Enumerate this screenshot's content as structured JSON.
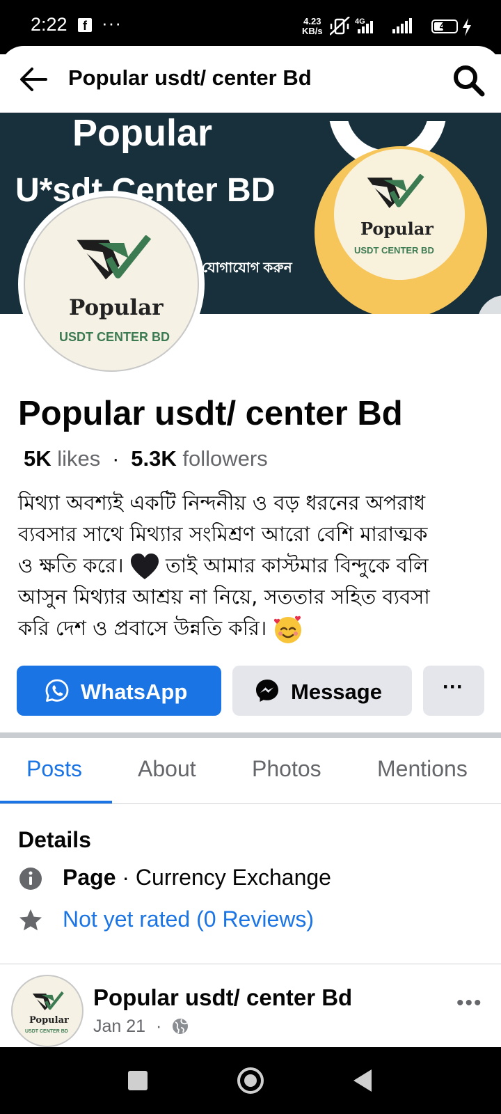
{
  "status_bar": {
    "time": "2:22",
    "notification_icons": [
      "facebook-icon",
      "more-notifications-icon"
    ],
    "network_speed_value": "4.23",
    "network_speed_unit": "KB/s",
    "network_type": "4G",
    "battery_level": "42"
  },
  "header": {
    "title": "Popular usdt/ center Bd",
    "back_icon": "back-arrow-icon",
    "search_icon": "search-icon"
  },
  "cover": {
    "line1": "Popular",
    "line2": "U*sdt Center BD",
    "line3": "যোগাযোগ করুন",
    "badge_word": "Popular",
    "badge_sub": "USDT CENTER BD"
  },
  "avatar": {
    "word": "Popular",
    "sub": "USDT CENTER BD"
  },
  "profile": {
    "name": "Popular usdt/ center Bd",
    "likes_count": "5K",
    "likes_label": "likes",
    "separator": "·",
    "followers_count": "5.3K",
    "followers_label": "followers",
    "bio_line1": "মিথ্যা অবশ্যই একটি নিন্দনীয় ও বড় ধরনের অপরাধ",
    "bio_line2": "ব্যবসার সাথে মিথ্যার সংমিশ্রণ আরো বেশি মারাত্মক",
    "bio_line3a": "ও ক্ষতি করে।",
    "bio_line3b": "তাই আমার কাস্টমার বিন্দুকে বলি",
    "bio_line4": "আসুন মিথ্যার আশ্রয় না নিয়ে,  সততার সহিত ব্যবসা",
    "bio_line5": "করি দেশ ও প্রবাসে উন্নতি করি।",
    "bio_emoji_1": "black-heart",
    "bio_emoji_2": "smiling-face-with-hearts"
  },
  "actions": {
    "whatsapp_label": "WhatsApp",
    "message_label": "Message",
    "more_label": "···"
  },
  "tabs": [
    {
      "label": "Posts",
      "active": true
    },
    {
      "label": "About",
      "active": false
    },
    {
      "label": "Photos",
      "active": false
    },
    {
      "label": "Mentions",
      "active": false
    }
  ],
  "details": {
    "title": "Details",
    "page_type_label": "Page",
    "page_type_sep": " · ",
    "page_type_value": "Currency Exchange",
    "rating_text": "Not yet rated (0 Reviews)"
  },
  "post": {
    "author": "Popular usdt/ center Bd",
    "date": "Jan 21",
    "date_sep": "·",
    "avatar_word": "Popular",
    "avatar_sub": "USDT CENTER BD",
    "more_label": "•••"
  },
  "nav": {
    "recents_icon": "recents-square-icon",
    "home_icon": "home-circle-icon",
    "back_icon": "back-triangle-icon"
  },
  "colors": {
    "brand_blue": "#1b74e4",
    "secondary_button": "#e4e6eb",
    "cover_background": "#17303c",
    "badge_yellow": "#f7c65b",
    "logo_green": "#3c7a52"
  }
}
